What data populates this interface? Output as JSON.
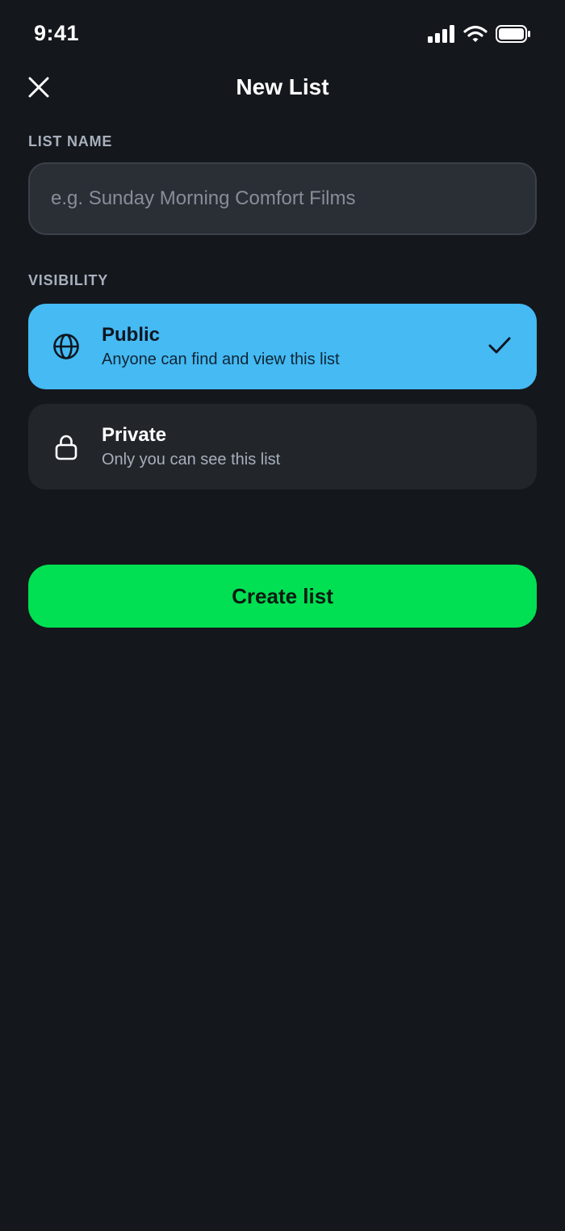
{
  "status_bar": {
    "time": "9:41",
    "icons": [
      "signal-icon",
      "wifi-icon",
      "battery-icon"
    ]
  },
  "header": {
    "title": "New List",
    "close_icon": "close-icon"
  },
  "form": {
    "list_name_label": "LIST NAME",
    "list_name_placeholder": "e.g. Sunday Morning Comfort Films",
    "list_name_value": "",
    "visibility_label": "VISIBILITY"
  },
  "visibility_options": [
    {
      "title": "Public",
      "description": "Anyone can find and view this list",
      "icon": "globe-icon",
      "selected": true
    },
    {
      "title": "Private",
      "description": "Only you can see this list",
      "icon": "lock-icon",
      "selected": false
    }
  ],
  "actions": {
    "create_label": "Create list"
  },
  "colors": {
    "background": "#14171c",
    "selected_option": "#45baf3",
    "unselected_option": "#22262b",
    "primary_button": "#00e052",
    "input_background": "#2a2e35",
    "label": "#a8b0bd"
  }
}
